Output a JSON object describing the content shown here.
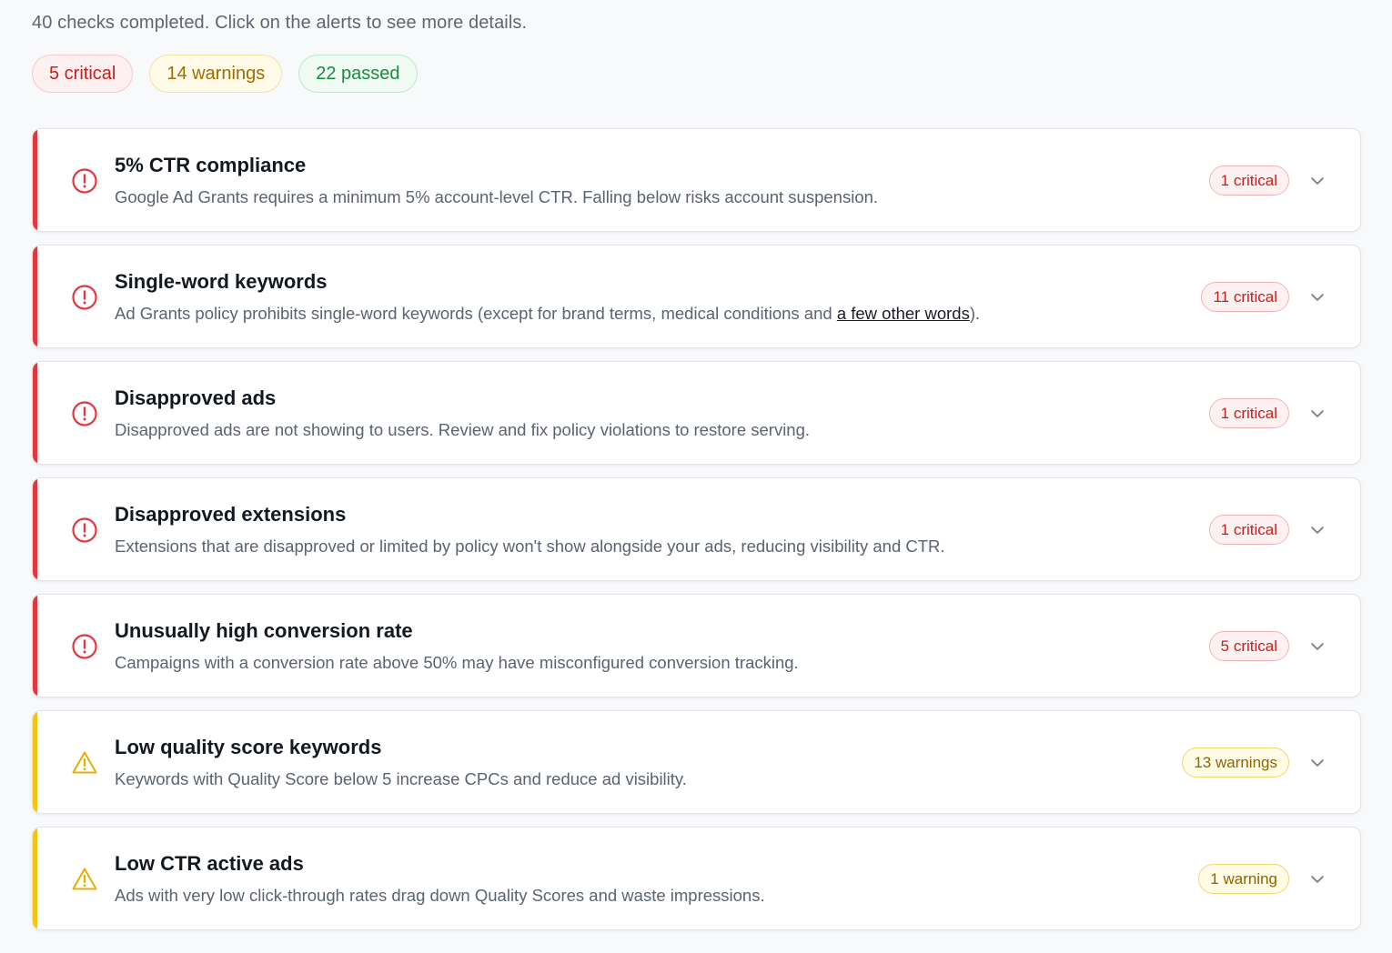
{
  "summary": {
    "text": "40 checks completed. Click on the alerts to see more details.",
    "critical_label": "5 critical",
    "warnings_label": "14 warnings",
    "passed_label": "22 passed"
  },
  "checks": [
    {
      "severity": "critical",
      "title": "5% CTR compliance",
      "description": "Google Ad Grants requires a minimum 5% account-level CTR. Falling below risks account suspension.",
      "badge": "1 critical"
    },
    {
      "severity": "critical",
      "title": "Single-word keywords",
      "description_before": "Ad Grants policy prohibits single-word keywords (except for brand terms, medical conditions and ",
      "description_link": "a few other words",
      "description_after": ").",
      "badge": "11 critical"
    },
    {
      "severity": "critical",
      "title": "Disapproved ads",
      "description": "Disapproved ads are not showing to users. Review and fix policy violations to restore serving.",
      "badge": "1 critical"
    },
    {
      "severity": "critical",
      "title": "Disapproved extensions",
      "description": "Extensions that are disapproved or limited by policy won't show alongside your ads, reducing visibility and CTR.",
      "badge": "1 critical"
    },
    {
      "severity": "critical",
      "title": "Unusually high conversion rate",
      "description": "Campaigns with a conversion rate above 50% may have misconfigured conversion tracking.",
      "badge": "5 critical"
    },
    {
      "severity": "warning",
      "title": "Low quality score keywords",
      "description": "Keywords with Quality Score below 5 increase CPCs and reduce ad visibility.",
      "badge": "13 warnings"
    },
    {
      "severity": "warning",
      "title": "Low CTR active ads",
      "description": "Ads with very low click-through rates drag down Quality Scores and waste impressions.",
      "badge": "1 warning"
    }
  ],
  "colors": {
    "critical": "#e5363b",
    "warning": "#f2c416",
    "passed": "#1c8a3f"
  },
  "icons": {
    "critical": "alert-circle-icon",
    "warning": "alert-triangle-icon",
    "expand": "chevron-down-icon"
  }
}
